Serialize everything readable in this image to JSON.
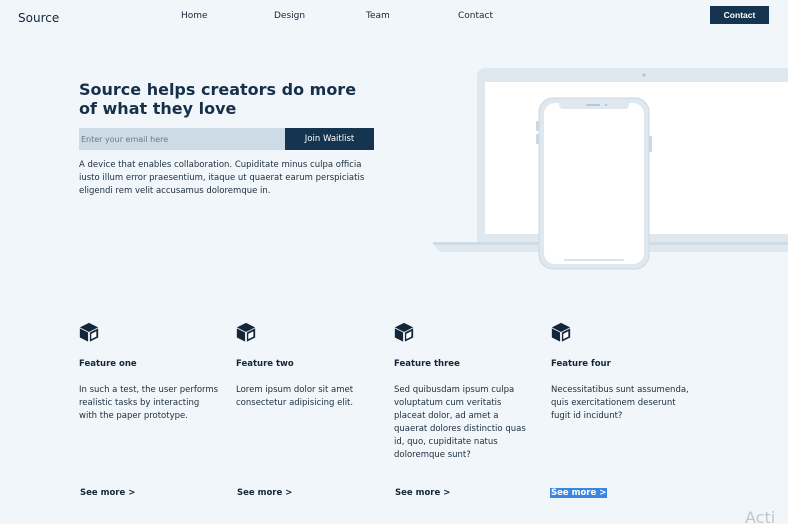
{
  "header": {
    "brand": "Source",
    "nav": [
      "Home",
      "Design",
      "Team",
      "Contact"
    ],
    "contact_button": "Contact"
  },
  "hero": {
    "title": "Source helps creators do more of what they love",
    "email_placeholder": "Enter your email here",
    "join_button": "Join Waitlist",
    "description": "A device that enables collaboration. Cupiditate minus culpa officia iusto illum error praesentium, itaque ut quaerat earum perspiciatis eligendi rem velit accusamus doloremque in."
  },
  "features": [
    {
      "icon": "cube-icon",
      "title": "Feature one",
      "description": "In such a test, the user performs realistic tasks by interacting with the paper prototype.",
      "link": "See more >"
    },
    {
      "icon": "cube-icon",
      "title": "Feature two",
      "description": "Lorem ipsum dolor sit amet consectetur adipisicing elit.",
      "link": "See more >"
    },
    {
      "icon": "cube-icon",
      "title": "Feature three",
      "description": "Sed quibusdam ipsum culpa voluptatum cum veritatis placeat dolor, ad amet a quaerat dolores distinctio quas id, quo, cupiditate natus doloremque sunt?",
      "link": "See more >"
    },
    {
      "icon": "cube-icon",
      "title": "Feature four",
      "description": "Necessitatibus sunt assumenda, quis exercitationem deserunt fugit id incidunt?",
      "link": "See more >"
    }
  ],
  "watermark": "Acti",
  "colors": {
    "accent": "#14344f",
    "background": "#f1f6fa",
    "input": "#cddbe6",
    "selection": "#3b87e0"
  }
}
